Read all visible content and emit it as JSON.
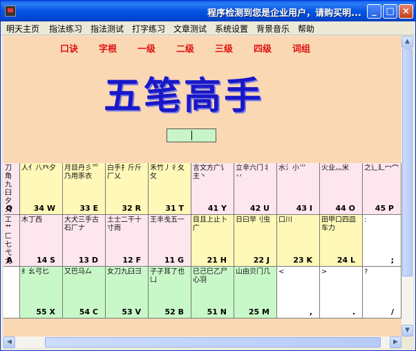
{
  "window": {
    "title": "程序检测到您是企业用户，请购买明..."
  },
  "menu": [
    "明天主页",
    "指法练习",
    "指法测试",
    "打字练习",
    "文章测试",
    "系统设置",
    "背景音乐",
    "帮助"
  ],
  "nav": [
    "口诀",
    "字根",
    "一级",
    "二级",
    "三级",
    "四级",
    "词组"
  ],
  "app_title": "五笔高手",
  "input_value": "",
  "keys": [
    {
      "roots": "刀角九臼夕夂夊",
      "label": "Q"
    },
    {
      "roots": "人亻八癶夕",
      "label": "34 W"
    },
    {
      "roots": "月目丹彡爫乃用豕衣",
      "label": "33 E"
    },
    {
      "roots": "白手扌斤斤厂乂",
      "label": "32 R"
    },
    {
      "roots": "禾竹丿彳夂攵",
      "label": "31 T"
    },
    {
      "roots": "言文方广讠主丶",
      "label": "41 Y"
    },
    {
      "roots": "立辛六门丬丷",
      "label": "42 U"
    },
    {
      "roots": "水氵小⺌",
      "label": "43 I"
    },
    {
      "roots": "火业灬米",
      "label": "44 O"
    },
    {
      "roots": "之辶廴冖宀",
      "label": "45 P"
    },
    {
      "roots": "工艹匚七弋戈",
      "label": "A"
    },
    {
      "roots": "木丁西",
      "label": "14 S"
    },
    {
      "roots": "大犬三手古石厂ナ",
      "label": "13 D"
    },
    {
      "roots": "土士二干十寸雨",
      "label": "12 F"
    },
    {
      "roots": "王丰戋五一",
      "label": "11 G"
    },
    {
      "roots": "目且上止卜广",
      "label": "21 H"
    },
    {
      "roots": "日曰早刂虫",
      "label": "22 J"
    },
    {
      "roots": "口川",
      "label": "23 K"
    },
    {
      "roots": "田甲口四皿车力",
      "label": "24 L"
    },
    {
      "roots": ":",
      "label": ";"
    },
    {
      "roots": "",
      "label": ""
    },
    {
      "roots": "纟幺弓匕",
      "label": "55 X"
    },
    {
      "roots": "又巴马厶",
      "label": "54 C"
    },
    {
      "roots": "女刀九臼彐",
      "label": "53 V"
    },
    {
      "roots": "子孑耳了也凵",
      "label": "52 B"
    },
    {
      "roots": "已己巳乙尸心羽",
      "label": "51 N"
    },
    {
      "roots": "山由贝门几",
      "label": "25 M"
    },
    {
      "roots": "<",
      "label": ","
    },
    {
      "roots": ">",
      "label": "."
    },
    {
      "roots": "?",
      "label": "/"
    }
  ]
}
